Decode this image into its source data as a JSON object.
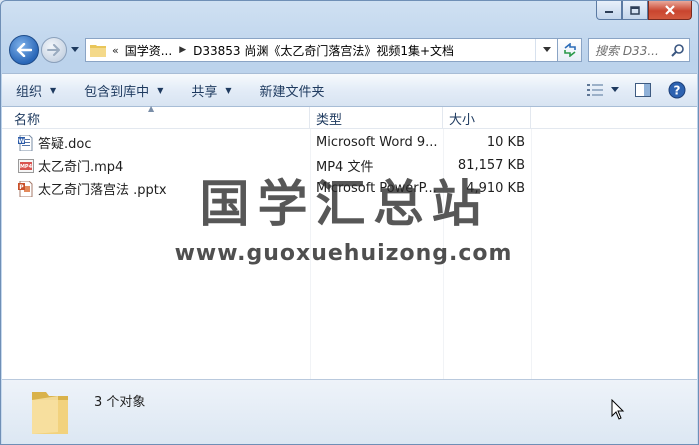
{
  "window": {
    "caption_buttons": [
      "minimize-icon",
      "maximize-icon",
      "close-icon"
    ]
  },
  "nav": {
    "overflow_chevron": "«",
    "breadcrumbs": [
      "国学资...",
      "D33853 尚渊《太乙奇门落宫法》视频1集+文档"
    ],
    "search_placeholder": "搜索 D33..."
  },
  "toolbar": {
    "organize": "组织",
    "include_in_library": "包含到库中",
    "share": "共享",
    "new_folder": "新建文件夹"
  },
  "columns": {
    "name": "名称",
    "type": "类型",
    "size": "大小"
  },
  "files": [
    {
      "name": "答疑.doc",
      "type": "Microsoft Word 9...",
      "size": "10 KB",
      "icon": "word-doc-icon"
    },
    {
      "name": "太乙奇门.mp4",
      "type": "MP4 文件",
      "size": "81,157 KB",
      "icon": "video-file-icon"
    },
    {
      "name": "太乙奇门落宫法 .pptx",
      "type": "Microsoft PowerP...",
      "size": "4,910 KB",
      "icon": "powerpoint-file-icon"
    }
  ],
  "watermark": {
    "title": "国学汇总站",
    "url": "www.guoxuehuizong.com"
  },
  "status": {
    "item_count": "3 个对象"
  },
  "colors": {
    "accent": "#1e3a5f",
    "close_button": "#c9452f",
    "window_frame": "#bcd3ec"
  }
}
